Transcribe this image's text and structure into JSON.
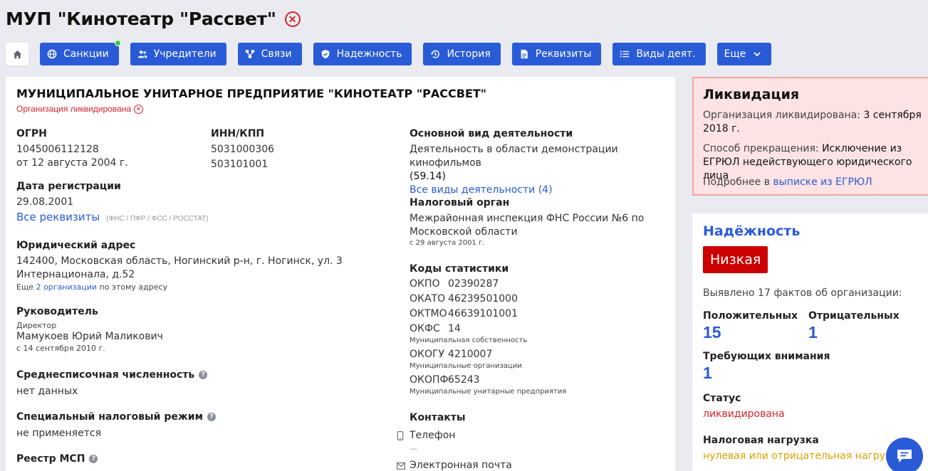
{
  "header": {
    "title": "МУП \"Кинотеатр \"Рассвет\""
  },
  "tabs": [
    {
      "label": "Санкции"
    },
    {
      "label": "Учредители"
    },
    {
      "label": "Связи"
    },
    {
      "label": "Надежность"
    },
    {
      "label": "История"
    },
    {
      "label": "Реквизиты"
    },
    {
      "label": "Виды деят."
    },
    {
      "label": "Еще"
    }
  ],
  "org": {
    "full_name": "МУНИЦИПАЛЬНОЕ УНИТАРНОЕ ПРЕДПРИЯТИЕ \"КИНОТЕАТР \"РАССВЕТ\"",
    "status_line": "Организация ликвидирована",
    "ogrn_label": "ОГРН",
    "ogrn": "1045006112128",
    "ogrn_date": "от 12 августа 2004 г.",
    "inn_label": "ИНН/КПП",
    "inn": "5031000306",
    "kpp": "503101001",
    "reg_label": "Дата регистрации",
    "reg_date": "29.08.2001",
    "all_req_link": "Все реквизиты",
    "all_req_note": "(ФНС / ПФР / ФСС / РОССТАТ)",
    "address_label": "Юридический адрес",
    "address": "142400, Московская область, Ногинский р-н, г. Ногинск, ул. 3 Интернационала, д.52",
    "address_more_pre": "Еще ",
    "address_more_link": "2 организации",
    "address_more_post": " по этому адресу",
    "head_label": "Руководитель",
    "head_role": "Директор",
    "head_name": "Мамукоев Юрий Маликович",
    "head_since": "с 14 сентября 2010 г.",
    "staff_label": "Среднесписочная численность",
    "staff_value": "нет данных",
    "tax_mode_label": "Специальный налоговый режим",
    "tax_mode_value": "не применяется",
    "msp_label": "Реестр МСП",
    "activity_label": "Основной вид деятельности",
    "activity": "Деятельность в области демонстрации кинофильмов",
    "activity_code": "(59.14)",
    "activity_all_link": "Все виды деятельности (4)",
    "tax_org_label": "Налоговый орган",
    "tax_org": "Межрайонная инспекция ФНС России №6 по Московской области",
    "tax_org_since": "с 29 августа 2001 г.",
    "codes_label": "Коды статистики",
    "codes": [
      {
        "k": "ОКПО",
        "v": "02390287",
        "note": ""
      },
      {
        "k": "ОКАТО",
        "v": "46239501000",
        "note": ""
      },
      {
        "k": "ОКТМО",
        "v": "46639101001",
        "note": ""
      },
      {
        "k": "ОКФС",
        "v": "14",
        "note": "Муниципальная собственность"
      },
      {
        "k": "ОКОГУ",
        "v": "4210007",
        "note": "Муниципальные организации"
      },
      {
        "k": "ОКОПФ",
        "v": "65243",
        "note": "Муниципальные унитарные предприятия"
      }
    ],
    "contacts_label": "Контакты",
    "phone_label": "Телефон",
    "phone_value": "—",
    "email_label": "Электронная почта"
  },
  "liquidation": {
    "title": "Ликвидация",
    "line1_pre": "Организация ликвидирована: ",
    "line1_val": "3 сентября 2018 г.",
    "line2_pre": "Способ прекращения: ",
    "line2_val": "Исключение из ЕГРЮЛ недействующего юридического лица",
    "line3_pre": "Подробнее в ",
    "line3_link": "выписке из ЕГРЮЛ"
  },
  "reliability": {
    "title": "Надёжность",
    "badge": "Низкая",
    "facts": "Выявлено 17 фактов об организации:",
    "pos_label": "Положительных",
    "pos_value": "15",
    "neg_label": "Отрицательных",
    "neg_value": "1",
    "attn_label": "Требующих внимания",
    "attn_value": "1",
    "status_label": "Статус",
    "status_value": "ликвидирована",
    "tax_label": "Налоговая нагрузка",
    "tax_value": "нулевая или отрицательная нагрузка"
  },
  "colors": {
    "accent": "#2a5bd7",
    "danger": "#d9232d",
    "warn": "#e0a100",
    "badge": "#cc0000"
  }
}
